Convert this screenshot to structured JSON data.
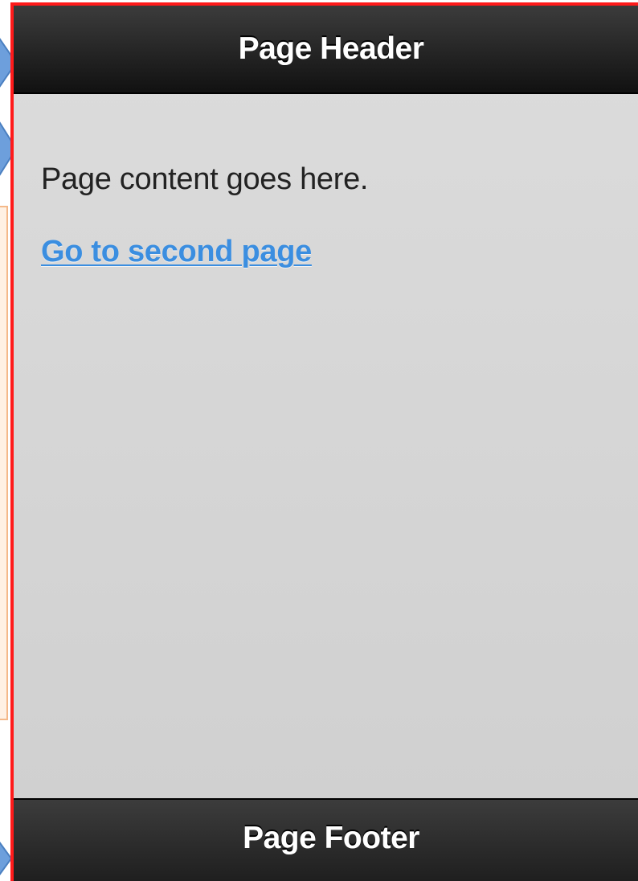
{
  "header": {
    "title": "Page Header"
  },
  "content": {
    "text": "Page content goes here.",
    "link_label": "Go to second page"
  },
  "footer": {
    "title": "Page Footer"
  },
  "colors": {
    "frame_border": "#ff1a1a",
    "bar_background": "#1c1c1c",
    "content_background": "#d6d6d6",
    "link": "#3b8ee0",
    "pointer": "#6d9fdc"
  }
}
